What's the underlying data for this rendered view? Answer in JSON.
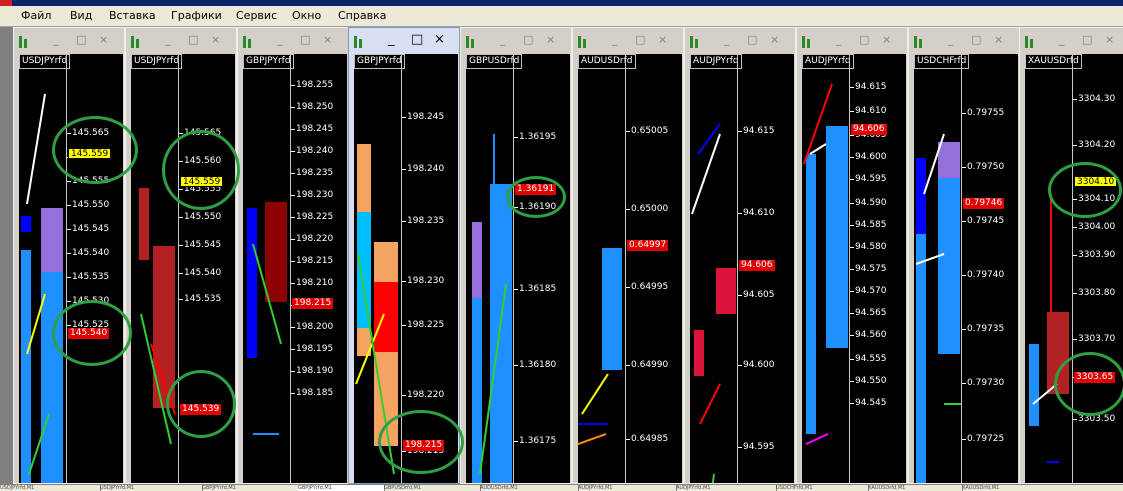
{
  "menu": [
    "Файл",
    "Вид",
    "Вставка",
    "Графики",
    "Сервис",
    "Окно",
    "Справка"
  ],
  "windows": [
    {
      "symbol": "USDJPYrfd",
      "active": false,
      "ticks": [
        "145.565",
        "145.560",
        "145.555",
        "145.550",
        "145.545",
        "145.540",
        "145.535",
        "145.530",
        "145.525"
      ],
      "labels": [
        {
          "text": "145.559",
          "style": "yellow"
        },
        {
          "text": "145.540",
          "style": "red"
        }
      ]
    },
    {
      "symbol": "USDJPYrfd",
      "active": false,
      "ticks": [
        "145.565",
        "145.560",
        "145.555",
        "145.550",
        "145.545",
        "145.540",
        "145.535"
      ],
      "labels": [
        {
          "text": "145.559",
          "style": "yellow"
        },
        {
          "text": "145.539",
          "style": "red"
        }
      ]
    },
    {
      "symbol": "GBPJPYrfd",
      "active": false,
      "ticks": [
        "198.255",
        "198.250",
        "198.245",
        "198.240",
        "198.235",
        "198.230",
        "198.225",
        "198.220",
        "198.215",
        "198.210",
        "198.205",
        "198.200",
        "198.195",
        "198.190",
        "198.185"
      ],
      "labels": [
        {
          "text": "198.215",
          "style": "red"
        }
      ]
    },
    {
      "symbol": "GBPJPYrfd",
      "active": true,
      "ticks": [
        "198.245",
        "198.240",
        "198.235",
        "198.230",
        "198.225",
        "198.220",
        "198.215"
      ],
      "labels": [
        {
          "text": "198.215",
          "style": "red"
        }
      ]
    },
    {
      "symbol": "GBPUSDrfd",
      "active": false,
      "ticks": [
        "1.36195",
        "1.36190",
        "1.36185",
        "1.36180",
        "1.36175"
      ],
      "labels": [
        {
          "text": "1.36191",
          "style": "red"
        }
      ]
    },
    {
      "symbol": "AUDUSDrfd",
      "active": false,
      "ticks": [
        "0.65005",
        "0.65000",
        "0.64995",
        "0.64990",
        "0.64985"
      ],
      "labels": [
        {
          "text": "0.64997",
          "style": "red"
        }
      ]
    },
    {
      "symbol": "AUDJPYrfd",
      "active": false,
      "ticks": [
        "94.615",
        "94.610",
        "94.605",
        "94.600",
        "94.595"
      ],
      "labels": [
        {
          "text": "94.606",
          "style": "red"
        }
      ]
    },
    {
      "symbol": "AUDJPYrfd",
      "active": false,
      "ticks": [
        "94.615",
        "94.610",
        "94.605",
        "94.600",
        "94.595",
        "94.590",
        "94.585",
        "94.580",
        "94.575",
        "94.570",
        "94.565",
        "94.560",
        "94.555",
        "94.550",
        "94.545"
      ],
      "labels": [
        {
          "text": "94.606",
          "style": "red"
        }
      ]
    },
    {
      "symbol": "USDCHFrfd",
      "active": false,
      "ticks": [
        "0.79755",
        "0.79750",
        "0.79745",
        "0.79740",
        "0.79735",
        "0.79730",
        "0.79725"
      ],
      "labels": [
        {
          "text": "0.79746",
          "style": "red"
        }
      ]
    },
    {
      "symbol": "XAUUSDrfd",
      "active": false,
      "ticks": [
        "3304.30",
        "3304.20",
        "3304.10",
        "3304.00",
        "3303.90",
        "3303.80",
        "3303.70",
        "3303.60",
        "3303.50"
      ],
      "labels": [
        {
          "text": "3304.10",
          "style": "yellow"
        },
        {
          "text": "3303.65",
          "style": "red"
        }
      ]
    }
  ],
  "tabs": [
    "USDJPYrfd,M1",
    "USDJPYrfd,M1",
    "GBPJPYrfd,M1",
    "GBPJPYrfd,M1",
    "GBPUSDrfd,M1",
    "AUDUSDrfd,M1",
    "AUDJPYrfd,M1",
    "AUDJPYrfd,M1",
    "USDCHFrfd,M1",
    "XAUUSDrfd,M1",
    "XAUUSDrfd,M1"
  ],
  "colors": {
    "bull": "#1e90ff",
    "bear": "#dc143c",
    "annotation": "#2ea043",
    "price_red": "#e00000",
    "price_yellow": "#ffff00",
    "chart_bg": "#000000"
  }
}
